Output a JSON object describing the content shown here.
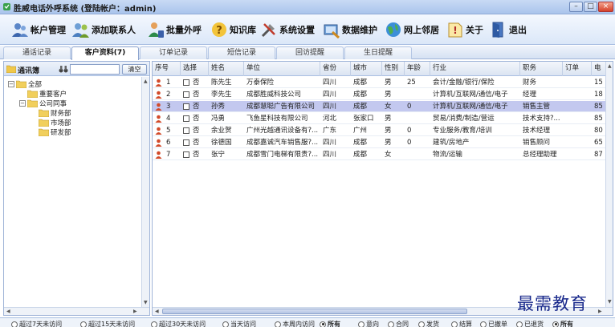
{
  "window": {
    "title": "胜威电话外呼系统 (登陆帐户：admin)",
    "minimize": "–",
    "maximize": "□",
    "close": "×"
  },
  "toolbar": [
    {
      "label": "帐户管理",
      "icon": "account-icon"
    },
    {
      "label": "添加联系人",
      "icon": "add-contact-icon"
    },
    {
      "label": "批量外呼",
      "icon": "batch-call-icon"
    },
    {
      "label": "知识库",
      "icon": "knowledge-icon"
    },
    {
      "label": "系统设置",
      "icon": "settings-icon"
    },
    {
      "label": "数据维护",
      "icon": "maintenance-icon"
    },
    {
      "label": "网上邻居",
      "icon": "network-icon"
    },
    {
      "label": "关于",
      "icon": "about-icon"
    },
    {
      "label": "退出",
      "icon": "exit-icon"
    }
  ],
  "tabs": [
    "通话记录",
    "客户资料(7)",
    "订单记录",
    "短信记录",
    "回访提醒",
    "生日提醒"
  ],
  "active_tab": 1,
  "contacts_panel": {
    "title": "通讯簿",
    "search_placeholder": "",
    "clear_label": "清空",
    "tree": [
      {
        "label": "全部",
        "level": 0,
        "toggle": "−"
      },
      {
        "label": "重要客户",
        "level": 1,
        "toggle": ""
      },
      {
        "label": "公司同事",
        "level": 1,
        "toggle": "−"
      },
      {
        "label": "财务部",
        "level": 2,
        "toggle": ""
      },
      {
        "label": "市场部",
        "level": 2,
        "toggle": ""
      },
      {
        "label": "研发部",
        "level": 2,
        "toggle": ""
      }
    ]
  },
  "grid": {
    "columns": [
      "序号",
      "选择",
      "姓名",
      "单位",
      "省份",
      "城市",
      "性别",
      "年龄",
      "行业",
      "职务",
      "订单",
      "电"
    ],
    "rows": [
      {
        "no": "1",
        "sel": "否",
        "name": "陈先生",
        "company": "万泰保险",
        "prov": "四川",
        "city": "成都",
        "sex": "男",
        "age": "25",
        "industry": "会计/金融/银行/保险",
        "title": "财务",
        "order": "",
        "tel": "15"
      },
      {
        "no": "2",
        "sel": "否",
        "name": "李先生",
        "company": "成都胜威科技公司",
        "prov": "四川",
        "city": "成都",
        "sex": "男",
        "age": "",
        "industry": "计算机/互联网/通信/电子",
        "title": "经理",
        "order": "",
        "tel": "18"
      },
      {
        "no": "3",
        "sel": "否",
        "name": "孙秀",
        "company": "成都慧聪广告有限公司",
        "prov": "四川",
        "city": "成都",
        "sex": "女",
        "age": "0",
        "industry": "计算机/互联网/通信/电子",
        "title": "销售主管",
        "order": "",
        "tel": "85"
      },
      {
        "no": "4",
        "sel": "否",
        "name": "冯勇",
        "company": "飞鱼星科技有限公司",
        "prov": "河北",
        "city": "张家口",
        "sex": "男",
        "age": "",
        "industry": "贸易/消费/制造/营运",
        "title": "技术支持?...",
        "order": "",
        "tel": "85"
      },
      {
        "no": "5",
        "sel": "否",
        "name": "余业贺",
        "company": "广州光越通讯设备有?...",
        "prov": "广东",
        "city": "广州",
        "sex": "男",
        "age": "0",
        "industry": "专业服务/教育/培训",
        "title": "技术经理",
        "order": "",
        "tel": "80"
      },
      {
        "no": "6",
        "sel": "否",
        "name": "徐德国",
        "company": "成都嘉诚汽车销售服?...",
        "prov": "四川",
        "city": "成都",
        "sex": "男",
        "age": "0",
        "industry": "建筑/房地产",
        "title": "销售顾问",
        "order": "",
        "tel": "65"
      },
      {
        "no": "7",
        "sel": "否",
        "name": "张宁",
        "company": "成都雪门电梯有限责?...",
        "prov": "四川",
        "city": "成都",
        "sex": "女",
        "age": "",
        "industry": "物流/运输",
        "title": "总经理助理",
        "order": "",
        "tel": "87"
      }
    ],
    "selected_row": 2
  },
  "filters": [
    {
      "label": "超过7天未访问",
      "on": false
    },
    {
      "label": "超过15天未访问",
      "on": false
    },
    {
      "label": "超过30天未访问",
      "on": false
    },
    {
      "label": "当天访问",
      "on": false
    },
    {
      "label": "本周内访问",
      "on": false
    },
    {
      "label": "所有",
      "on": true
    },
    {
      "label": "意向",
      "on": false
    },
    {
      "label": "合同",
      "on": false
    },
    {
      "label": "发货",
      "on": false
    },
    {
      "label": "结算",
      "on": false
    },
    {
      "label": "已撤单",
      "on": false
    },
    {
      "label": "已退货",
      "on": false
    },
    {
      "label": "所有",
      "on": true
    }
  ],
  "watermark": "最需教育",
  "colors": {
    "selected_row": "#c3c8ef",
    "titlebar": "#aac4ec",
    "watermark": "#1a2a8c"
  }
}
